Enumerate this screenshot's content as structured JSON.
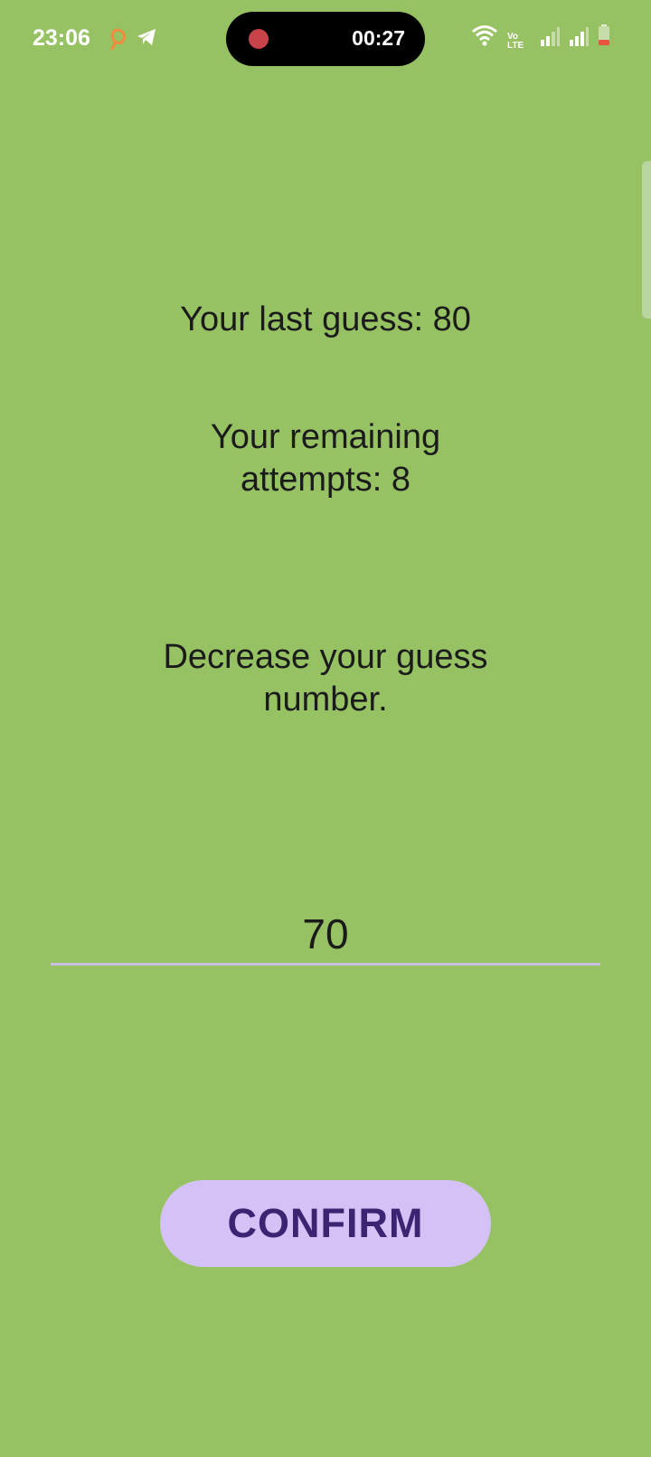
{
  "status_bar": {
    "time": "23:06",
    "recording_timer": "00:27",
    "network_label": "Vo\nLTE",
    "icons": [
      "app-notification-icon",
      "telegram-icon",
      "wifi-icon",
      "volte-icon",
      "signal-icon",
      "signal-icon",
      "battery-icon"
    ]
  },
  "game": {
    "last_guess_text": "Your last guess: 80",
    "remaining_attempts_text": "Your remaining attempts: 8",
    "hint_text": "Decrease your guess number.",
    "guess_input_value": "70",
    "confirm_label": "CONFIRM"
  },
  "colors": {
    "background": "#97c263",
    "button_bg": "#d4c1f5",
    "button_text": "#3b2472",
    "input_underline": "#c8bfe0",
    "recording_dot": "#c9444a",
    "battery_low": "#e8553f"
  }
}
